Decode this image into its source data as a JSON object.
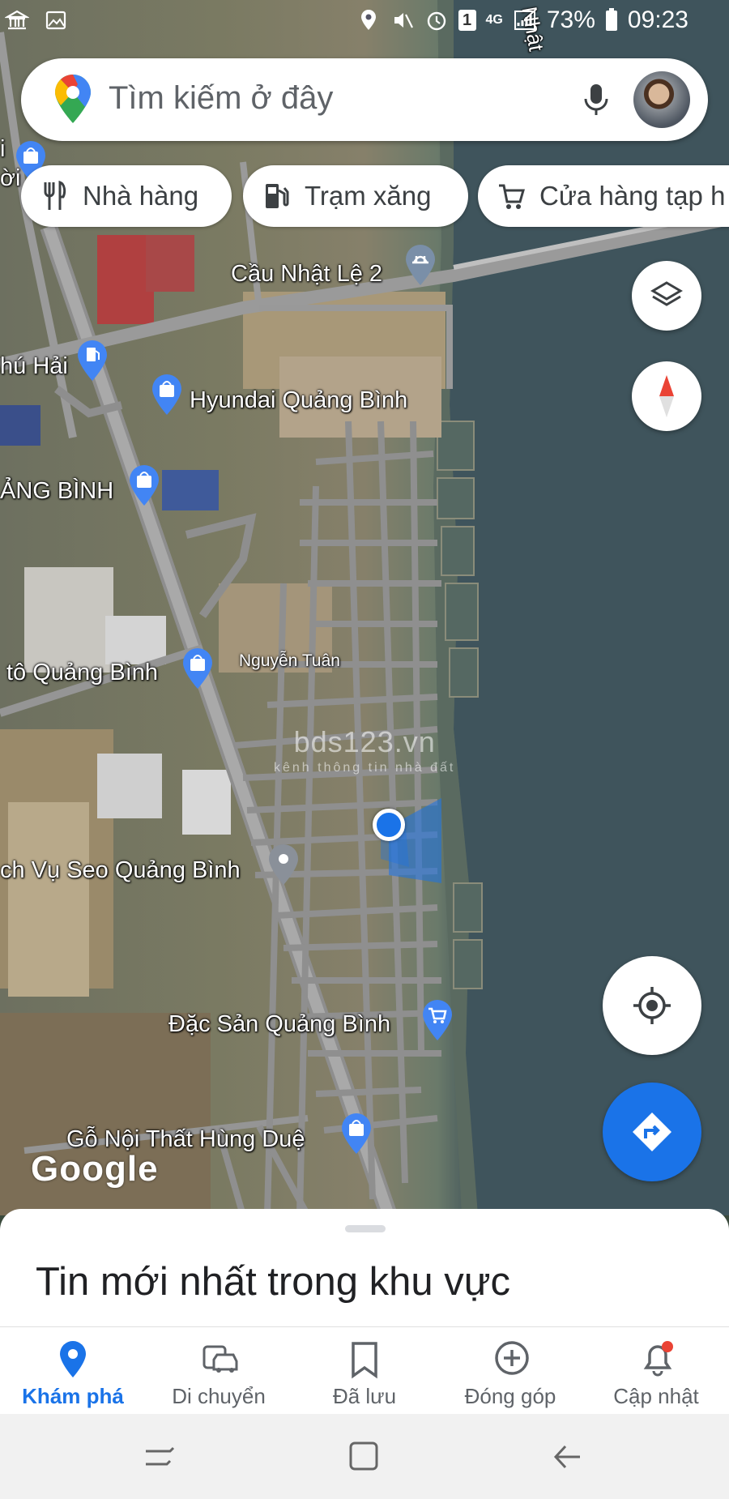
{
  "status_bar": {
    "battery": "73%",
    "time": "09:23",
    "sim_badge": "1",
    "network": "4G"
  },
  "search": {
    "placeholder": "Tìm kiếm ở đây"
  },
  "chips": [
    {
      "label": "Nhà hàng",
      "icon": "restaurant-icon"
    },
    {
      "label": "Trạm xăng",
      "icon": "gas-station-icon"
    },
    {
      "label": "Cửa hàng tạp h",
      "icon": "shopping-cart-icon"
    }
  ],
  "map": {
    "labels": {
      "cau_nhat_le": "Cầu Nhật Lệ 2",
      "phu_hai": "hú Hải",
      "hyundai": "Hyundai Quảng Bình",
      "quang_binh": "ẢNG BÌNH",
      "nguyen_tuan": "Nguyễn Tuân",
      "oto": "tô Quảng Bình",
      "seo": "ch Vụ Seo Quảng Bình",
      "dac_san": "Đặc Sản Quảng Bình",
      "go_noi_that": "Gỗ Nội Thất Hùng Duệ",
      "top_edge": "i",
      "top_edge2": "ời",
      "river_text": "Nhật"
    },
    "watermark_main": "bds123.vn",
    "watermark_sub": "kênh thông tin nhà đất",
    "google": "Google"
  },
  "sheet": {
    "title": "Tin mới nhất trong khu vực"
  },
  "bottom_nav": [
    {
      "label": "Khám phá",
      "icon": "explore-pin-icon",
      "active": true
    },
    {
      "label": "Di chuyển",
      "icon": "commute-icon",
      "active": false
    },
    {
      "label": "Đã lưu",
      "icon": "bookmark-icon",
      "active": false
    },
    {
      "label": "Đóng góp",
      "icon": "add-circle-icon",
      "active": false
    },
    {
      "label": "Cập nhật",
      "icon": "bell-icon",
      "active": false
    }
  ],
  "colors": {
    "accent": "#1a73e8",
    "location_dot": "#1a73e8",
    "notification_dot": "#ea4335"
  }
}
